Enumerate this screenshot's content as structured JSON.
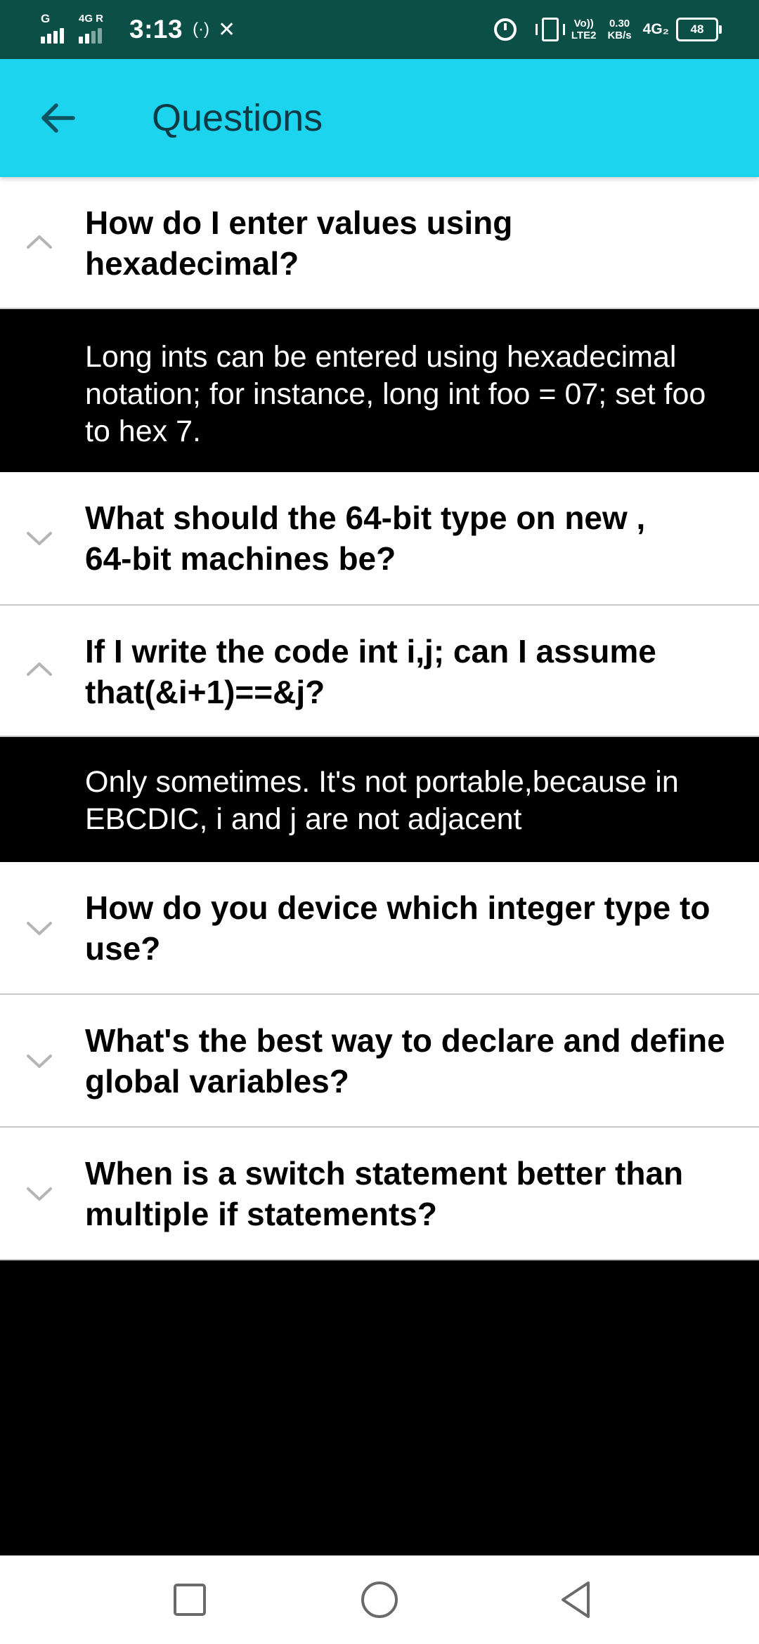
{
  "status_bar": {
    "time": "3:13",
    "sim1_tag": "G",
    "sim2_tag": "4G R",
    "hotspot_glyph": "(·)",
    "tools_glyph": "✕",
    "volte_top": "Vo))",
    "volte_bottom": "LTE2",
    "speed_top": "0.30",
    "speed_bottom": "KB/s",
    "network": "4G₂",
    "battery": "48",
    "icons": [
      "signal-icon",
      "signal-roaming-icon",
      "hotspot-icon",
      "tools-icon",
      "alarm-icon",
      "vibrate-icon",
      "battery-icon"
    ]
  },
  "app_bar": {
    "title": "Questions",
    "back_icon": "arrow-left-icon",
    "background": "#1dd4ee",
    "title_color": "#0d3a45"
  },
  "faq": [
    {
      "question": "How do I enter values using\nhexadecimal?",
      "expanded": true,
      "answer": "Long ints can be entered using hexadecimal\nnotation; for instance, long int foo = 07; set foo\nto hex 7."
    },
    {
      "question": "What should the 64-bit type on new ,\n64-bit machines be?",
      "expanded": false
    },
    {
      "question": "If I write the code int i,j; can I assume\nthat(&i+1)==&j?",
      "expanded": true,
      "answer": "Only sometimes. It's not portable,because in\nEBCDIC, i and j are not adjacent"
    },
    {
      "question": "How do you device which integer type to\nuse?",
      "expanded": false
    },
    {
      "question": "What's the best way to declare and define\nglobal variables?",
      "expanded": false
    },
    {
      "question": "When is a switch statement better than\nmultiple if statements?",
      "expanded": false
    }
  ],
  "nav_bar": {
    "icons": [
      "recents-square-icon",
      "home-circle-icon",
      "back-triangle-icon"
    ]
  }
}
